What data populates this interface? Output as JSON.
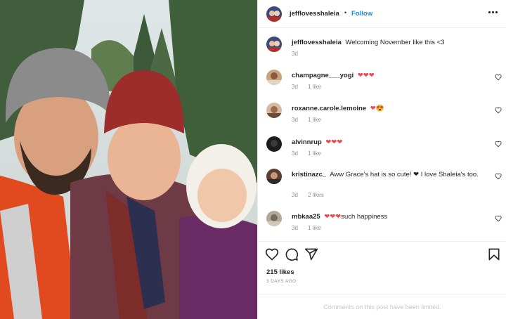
{
  "post": {
    "author": "jefflovesshaleia",
    "follow_label": "Follow",
    "dot": "•",
    "caption": "Welcoming November like this <3",
    "caption_time": "3d"
  },
  "comments": [
    {
      "user": "champagne___yogi",
      "text": "",
      "emoji": "❤❤❤",
      "time": "3d",
      "likes": "1 like"
    },
    {
      "user": "roxanne.carole.lemoine",
      "text": "",
      "emoji": "❤😍",
      "time": "3d",
      "likes": "1 like"
    },
    {
      "user": "alvinnrup",
      "text": "",
      "emoji": "❤❤❤",
      "time": "3d",
      "likes": "1 like"
    },
    {
      "user": "kristinazc_",
      "text": "Aww Grace's hat is so cute! ❤ I love Shaleia's too.",
      "emoji": "",
      "time": "3d",
      "likes": "2 likes"
    },
    {
      "user": "mbkaa25",
      "text": "such happiness",
      "emoji": "❤❤❤",
      "time": "3d",
      "likes": "1 like"
    }
  ],
  "footer": {
    "likes": "215 likes",
    "date": "3 DAYS AGO",
    "limited": "Comments on this post have been limited."
  },
  "icons": [
    "heart-icon",
    "comment-icon",
    "share-icon",
    "bookmark-icon",
    "more-icon"
  ],
  "colors": {
    "follow": "#0095f6",
    "heart": "#ed4956",
    "muted": "#8e8e8e"
  }
}
